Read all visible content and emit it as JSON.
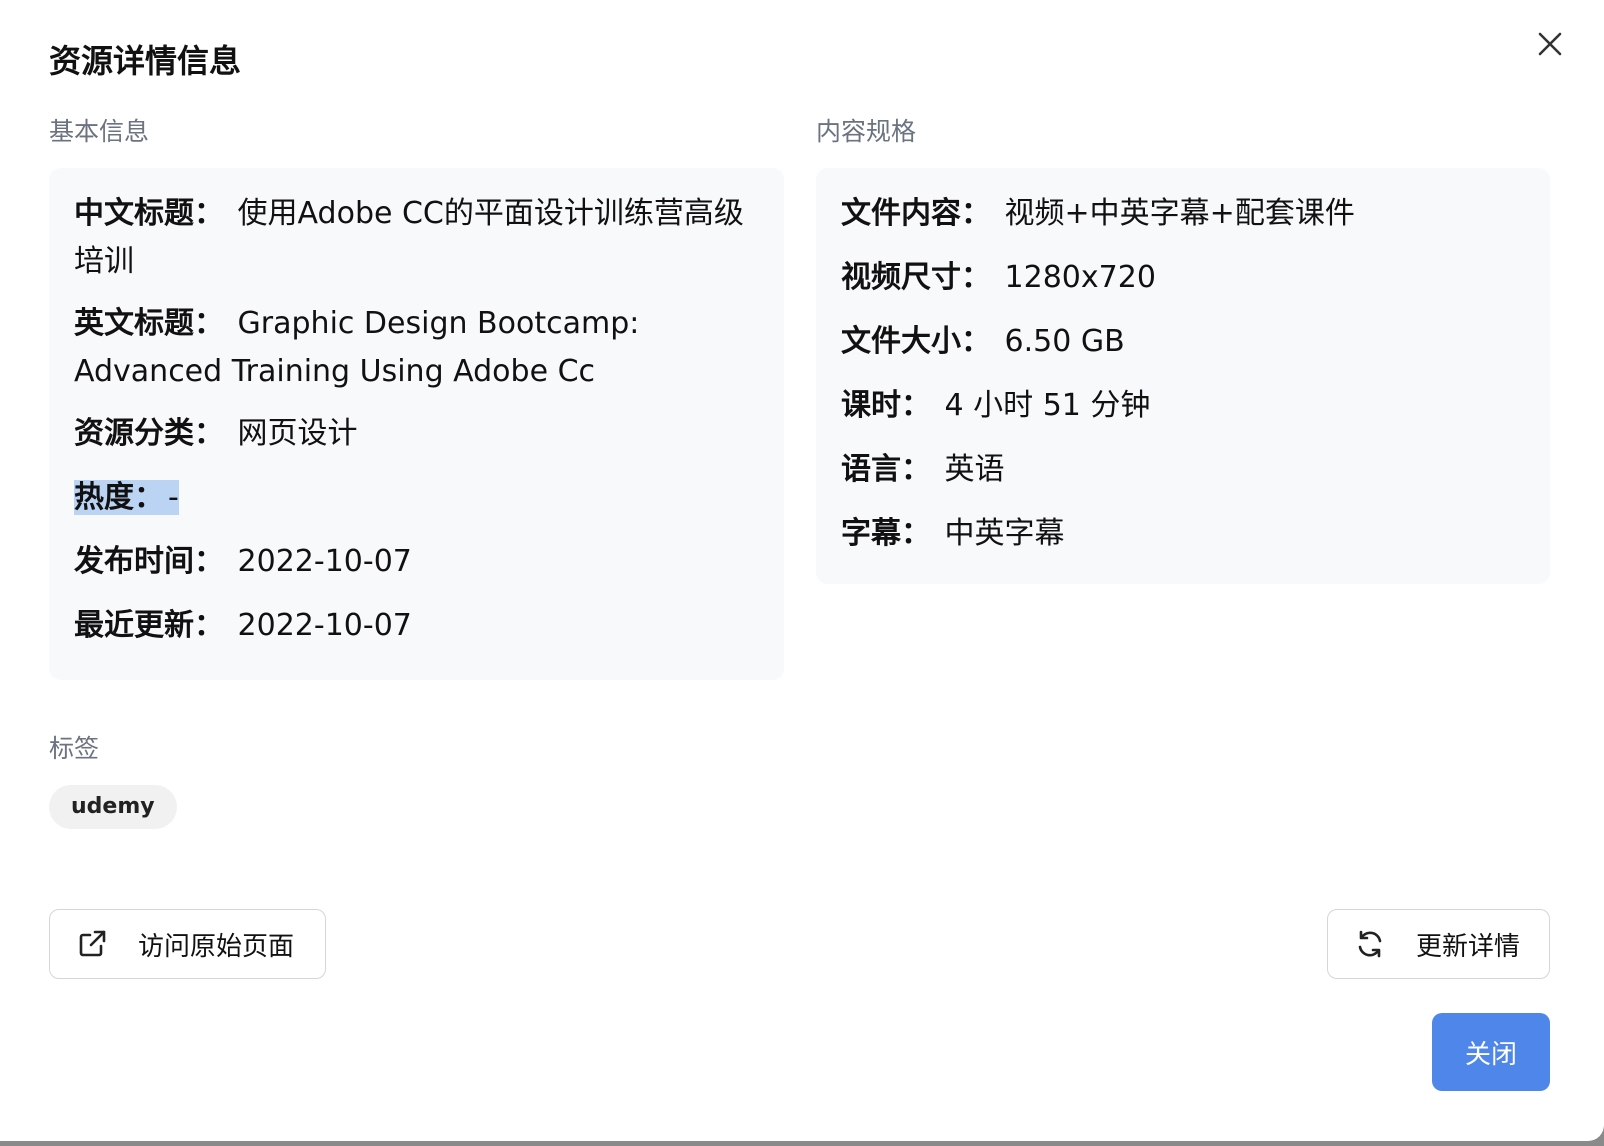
{
  "dialog": {
    "title": "资源详情信息"
  },
  "basic_info": {
    "heading": "基本信息",
    "rows": [
      {
        "label": "中文标题：",
        "value": "使用Adobe CC的平面设计训练营高级培训"
      },
      {
        "label": "英文标题：",
        "value": "Graphic Design Bootcamp: Advanced Training Using Adobe Cc"
      },
      {
        "label": "资源分类：",
        "value": "网页设计"
      },
      {
        "label": "热度：",
        "value": "-"
      },
      {
        "label": "发布时间：",
        "value": "2022-10-07"
      },
      {
        "label": "最近更新：",
        "value": "2022-10-07"
      }
    ]
  },
  "content_spec": {
    "heading": "内容规格",
    "rows": [
      {
        "label": "文件内容：",
        "value": "视频+中英字幕+配套课件"
      },
      {
        "label": "视频尺寸：",
        "value": "1280x720"
      },
      {
        "label": "文件大小：",
        "value": "6.50 GB"
      },
      {
        "label": "课时：",
        "value": "4 小时 51 分钟"
      },
      {
        "label": "语言：",
        "value": "英语"
      },
      {
        "label": "字幕：",
        "value": "中英字幕"
      }
    ]
  },
  "tags": {
    "heading": "标签",
    "items": [
      "udemy"
    ]
  },
  "actions": {
    "visit_original": {
      "label": "访问原始页面",
      "icon": "external-link-icon"
    },
    "refresh_details": {
      "label": "更新详情",
      "icon": "refresh-icon"
    },
    "close": {
      "label": "关闭"
    }
  },
  "colors": {
    "primary": "#4e86ea",
    "panel_bg": "#f8f9fb",
    "muted_text": "#6b7280",
    "selection": "#bcd4f3"
  }
}
